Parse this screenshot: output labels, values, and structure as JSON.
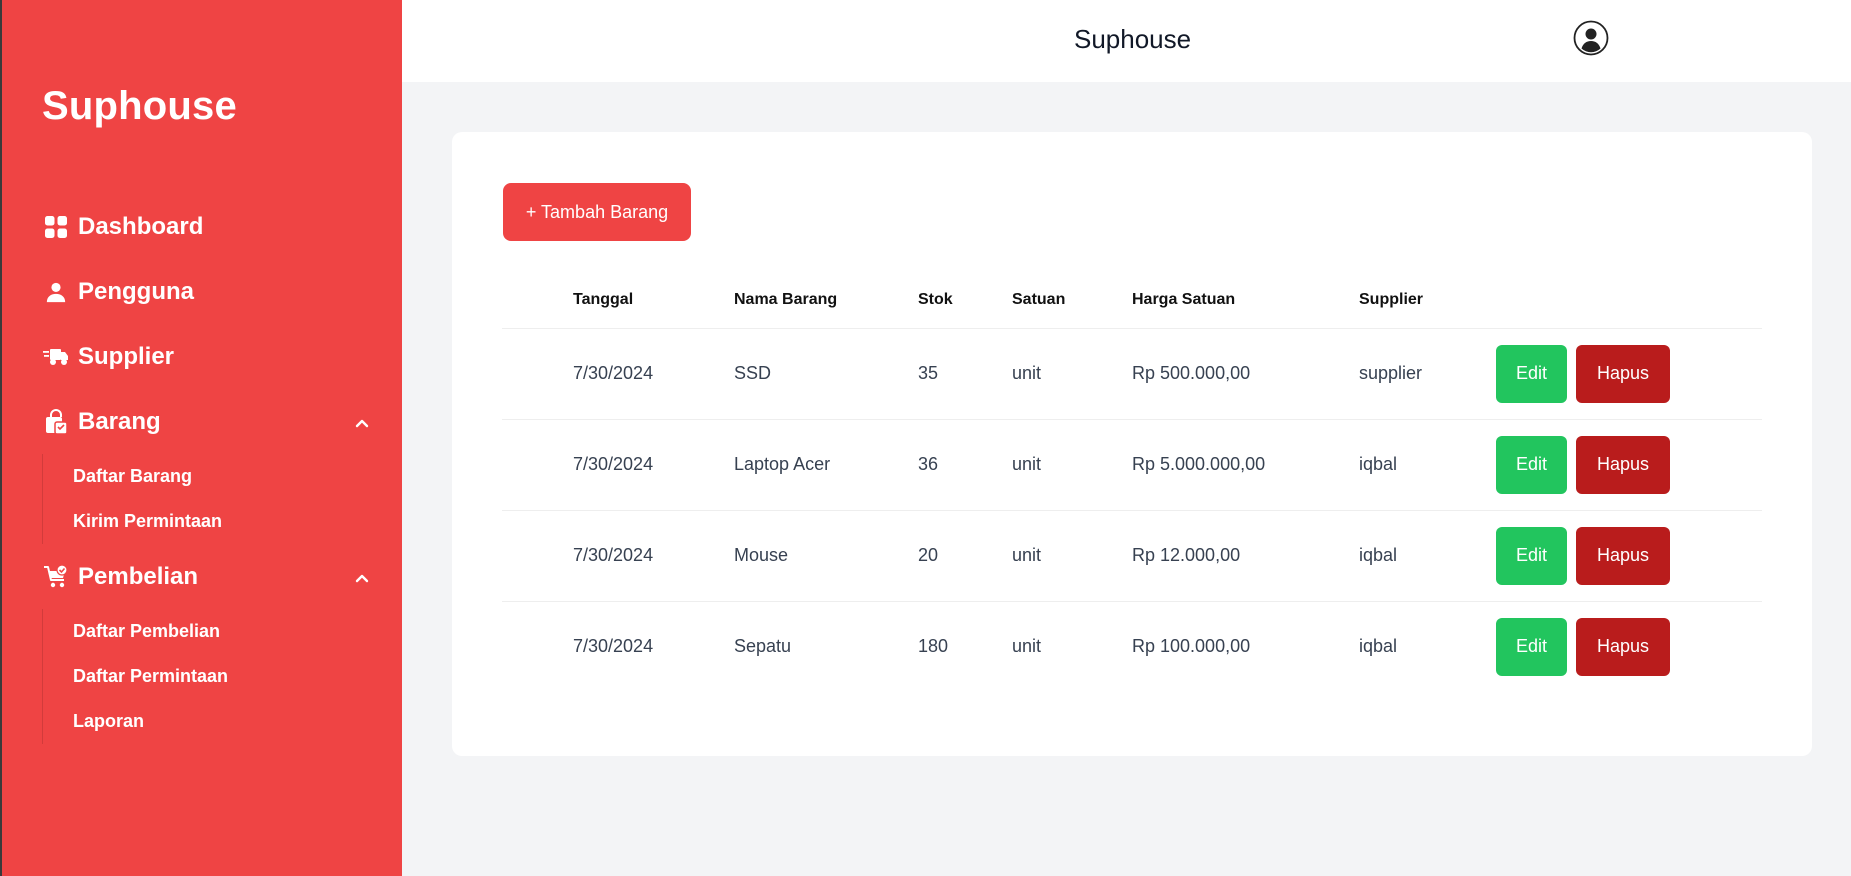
{
  "colors": {
    "sidebar_bg": "#ef4444",
    "primary": "#ef4444",
    "edit": "#22c55e",
    "delete": "#b91c1c"
  },
  "sidebar": {
    "brand": "Suphouse",
    "items": [
      {
        "label": "Dashboard",
        "icon": "dashboard-grid-icon"
      },
      {
        "label": "Pengguna",
        "icon": "user-icon"
      },
      {
        "label": "Supplier",
        "icon": "truck-icon"
      },
      {
        "label": "Barang",
        "icon": "shopping-bag-icon",
        "expanded": true,
        "children": [
          "Daftar Barang",
          "Kirim Permintaan"
        ]
      },
      {
        "label": "Pembelian",
        "icon": "cart-check-icon",
        "expanded": true,
        "children": [
          "Daftar Pembelian",
          "Daftar Permintaan",
          "Laporan"
        ]
      }
    ]
  },
  "header": {
    "title": "Suphouse",
    "avatar_icon": "user-circle-icon"
  },
  "main": {
    "add_button": "+ Tambah Barang",
    "table": {
      "columns": [
        "Tanggal",
        "Nama Barang",
        "Stok",
        "Satuan",
        "Harga Satuan",
        "Supplier"
      ],
      "rows": [
        {
          "tanggal": "7/30/2024",
          "nama": "SSD",
          "stok": "35",
          "satuan": "unit",
          "harga": "Rp 500.000,00",
          "supplier": "supplier"
        },
        {
          "tanggal": "7/30/2024",
          "nama": "Laptop Acer",
          "stok": "36",
          "satuan": "unit",
          "harga": "Rp 5.000.000,00",
          "supplier": "iqbal"
        },
        {
          "tanggal": "7/30/2024",
          "nama": "Mouse",
          "stok": "20",
          "satuan": "unit",
          "harga": "Rp 12.000,00",
          "supplier": "iqbal"
        },
        {
          "tanggal": "7/30/2024",
          "nama": "Sepatu",
          "stok": "180",
          "satuan": "unit",
          "harga": "Rp 100.000,00",
          "supplier": "iqbal"
        }
      ],
      "edit_label": "Edit",
      "delete_label": "Hapus"
    }
  }
}
